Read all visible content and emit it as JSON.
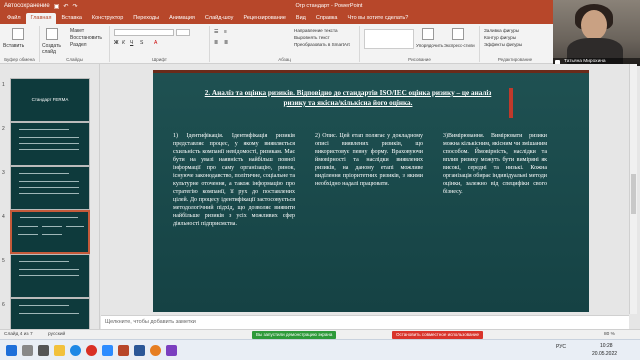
{
  "titlebar": {
    "autosave": "Автосохранение",
    "doc_title": "Огр стандарт - PowerPoint",
    "user": "Алена Ящено"
  },
  "tabs": [
    "Файл",
    "Главная",
    "Вставка",
    "Конструктор",
    "Переходы",
    "Анимация",
    "Слайд-шоу",
    "Рецензирование",
    "Вид",
    "Справка",
    "Что вы хотите сделать?"
  ],
  "ribbon": {
    "paste": "Вставить",
    "clipboard": "Буфер обмена",
    "new_slide": "Создать слайд",
    "layout": "Макет",
    "reset": "Восстановить",
    "section": "Раздел",
    "slides": "Слайды",
    "font": "Шрифт",
    "paragraph": "Абзац",
    "text_direction": "Направление текста",
    "align_text": "Выровнять текст",
    "smartart": "Преобразовать в SmartArt",
    "drawing": "Рисование",
    "arrange": "Упорядочить",
    "quick_styles": "Экспресс-стили",
    "fill": "Заливка фигуры",
    "outline": "Контур фигуры",
    "effects": "Эффекты фигуры",
    "find": "Найти",
    "replace": "Заменить",
    "select": "Выделить",
    "editing": "Редактирование"
  },
  "thumbnails": [
    {
      "num": "1",
      "title": "Стандарт FERMA"
    },
    {
      "num": "2",
      "title": ""
    },
    {
      "num": "3",
      "title": ""
    },
    {
      "num": "4",
      "title": ""
    },
    {
      "num": "5",
      "title": ""
    },
    {
      "num": "6",
      "title": ""
    }
  ],
  "slide": {
    "title": "2. Аналіз та оцінка ризиків. Відповідно до стандартів ISO/IEC оцінка ризику – це аналіз ризику та якісна/кількісна його оцінка.",
    "col1": "1) Ідентифікація. Ідентифікація ризиків представляє процес, у якому виявляється схильність компанії невідомості, ризикам. Має бути на увазі наявність найбільш повної інформації про саму організацію, ринок, існуюче законодавство, політичне, соціальне та культурне оточення, а також інформацію про стратегію компанії, її рух до поставлених цілей. До процесу ідентифікації застосовується методологічний підхід, що дозволяє виявити найбільше ризиків з усіх можливих сфер діяльності підприємства.",
    "col2": "2) Опис. Цей етап полягає у докладному описі виявлених ризиків, що використовує певну форму. Враховуючи ймовірності та наслідки виявлених ризиків, на даному етапі можливе виділення пріоритетних ризиків, з якими необхідно надалі працювати.",
    "col3": "3)Вимірювання. Вимірювати ризики можна кількісним, якісним чи змішаним способом. Ймовірність, наслідки та вплив ризику можуть бути виміряні як високі, середні та низькі. Кожна організація обирає індивідуальні методи оцінки, залежно від специфіки свого бізнесу."
  },
  "notes_placeholder": "Щелкните, чтобы добавить заметки",
  "status": {
    "slide_counter": "Слайд 4 из 7",
    "language": "русский",
    "sharing": "Вы запустили демонстрацию экрана",
    "stop_sharing": "Остановить совместное использование",
    "zoom": "80 %"
  },
  "video": {
    "name": "Татьяна Мирохина"
  },
  "tray": {
    "lang": "РУС",
    "time": "10:28",
    "date": "20.05.2022"
  },
  "colors": {
    "accent": "#b7472a",
    "slide_bg": "#1b4b4c",
    "share_green": "#2e9a3a",
    "share_red": "#d9342b"
  }
}
